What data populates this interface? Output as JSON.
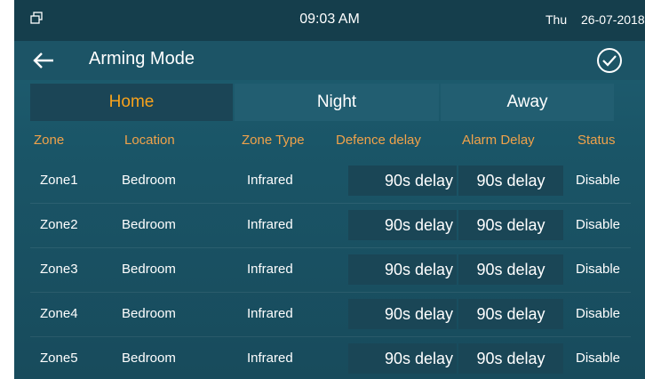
{
  "status_bar": {
    "time": "09:03 AM",
    "day": "Thu",
    "date": "26-07-2018"
  },
  "header": {
    "title": "Arming Mode"
  },
  "tabs": [
    {
      "label": "Home",
      "active": true
    },
    {
      "label": "Night",
      "active": false
    },
    {
      "label": "Away",
      "active": false
    }
  ],
  "table": {
    "columns": [
      "Zone",
      "Location",
      "Zone Type",
      "Defence delay",
      "Alarm Delay",
      "Status"
    ],
    "rows": [
      {
        "zone": "Zone1",
        "location": "Bedroom",
        "zone_type": "Infrared",
        "defence_delay": "90s delay",
        "alarm_delay": "90s delay",
        "status": "Disable"
      },
      {
        "zone": "Zone2",
        "location": "Bedroom",
        "zone_type": "Infrared",
        "defence_delay": "90s delay",
        "alarm_delay": "90s delay",
        "status": "Disable"
      },
      {
        "zone": "Zone3",
        "location": "Bedroom",
        "zone_type": "Infrared",
        "defence_delay": "90s delay",
        "alarm_delay": "90s delay",
        "status": "Disable"
      },
      {
        "zone": "Zone4",
        "location": "Bedroom",
        "zone_type": "Infrared",
        "defence_delay": "90s delay",
        "alarm_delay": "90s delay",
        "status": "Disable"
      },
      {
        "zone": "Zone5",
        "location": "Bedroom",
        "zone_type": "Infrared",
        "defence_delay": "90s delay",
        "alarm_delay": "90s delay",
        "status": "Disable"
      }
    ]
  },
  "colors": {
    "accent": "#f7a21c",
    "header_text": "#f0a24a",
    "background": "#1a5567"
  },
  "icons": {
    "window": "window-icon",
    "back": "back-arrow-icon",
    "confirm": "check-circle-icon"
  }
}
